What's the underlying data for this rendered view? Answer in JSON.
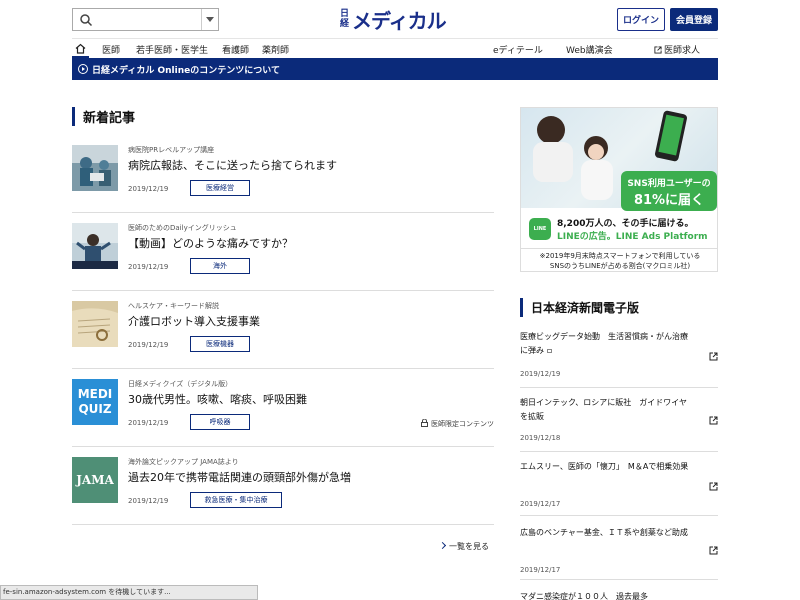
{
  "header": {
    "logo_small": "日経",
    "logo_main": "メディカル",
    "search_placeholder": "",
    "login_label": "ログイン",
    "register_label": "会員登録"
  },
  "nav": {
    "items": [
      "医師",
      "若手医師・医学生",
      "看護師",
      "薬剤師"
    ],
    "right_items": [
      "eディテール",
      "Web講演会"
    ],
    "job_label": "医師求人"
  },
  "infobar": {
    "text": "日経メディカル Onlineのコンテンツについて"
  },
  "main": {
    "section_title": "新着記事",
    "articles": [
      {
        "category": "病医院PRレベルアップ講座",
        "title": "病院広報誌、そこに送ったら捨てられます",
        "date": "2019/12/19",
        "tag": "医療経営",
        "limited": ""
      },
      {
        "category": "医師のためのDailyイングリッシュ",
        "title": "【動画】どのような痛みですか？",
        "date": "2019/12/19",
        "tag": "海外",
        "limited": ""
      },
      {
        "category": "ヘルスケア・キーワード解説",
        "title": "介護ロボット導入支援事業",
        "date": "2019/12/19",
        "tag": "医療機器",
        "limited": ""
      },
      {
        "category": "日経メディクイズ（デジタル版）",
        "title": "30歳代男性。咳嗽、喀痰、呼吸困難",
        "date": "2019/12/19",
        "tag": "呼吸器",
        "limited": "医師限定コンテンツ",
        "thumb_text": [
          "MEDI",
          "QUIZ"
        ]
      },
      {
        "category": "海外論文ピックアップ JAMA誌より",
        "title": "過去20年で携帯電話関連の頭頸部外傷が急増",
        "date": "2019/12/19",
        "tag": "救急医療・集中治療",
        "limited": "",
        "thumb_text": [
          "JAMA"
        ]
      }
    ],
    "more_label": "一覧を見る"
  },
  "ad": {
    "bubble_l1": "SNS利用ユーザーの",
    "bubble_l2": "81%に届く",
    "logo_text": "LINE",
    "line1": "8,200万人の、その手に届ける。",
    "line2": "LINEの広告。LINE Ads Platform",
    "note1": "※2019年9月末時点スマートフォンで利用している",
    "note2": "SNSのうちLINEが占める割合(マクロミル社)"
  },
  "sidebar": {
    "title": "日本経済新聞電子版",
    "news": [
      {
        "headline": "医療ビッグデータ始動　生活習慣病・がん治療に弾み",
        "date": "2019/12/19"
      },
      {
        "headline": "朝日インテック、ロシアに販社　ガイドワイヤを拡販",
        "date": "2019/12/18"
      },
      {
        "headline": "エムスリー、医師の「懐刀」　M＆Aで相乗効果",
        "date": "2019/12/17"
      },
      {
        "headline": "広島のベンチャー基金、ＩＴ系や創薬など助成",
        "date": "2019/12/17"
      },
      {
        "headline": "マダニ感染症が１００人　過去最多　",
        "date": ""
      }
    ]
  },
  "status": {
    "text": "fe-sin.amazon-adsystem.com を待機しています..."
  },
  "colors": {
    "brand_navy": "#0b2a7a",
    "line_green": "#3cae4f"
  }
}
